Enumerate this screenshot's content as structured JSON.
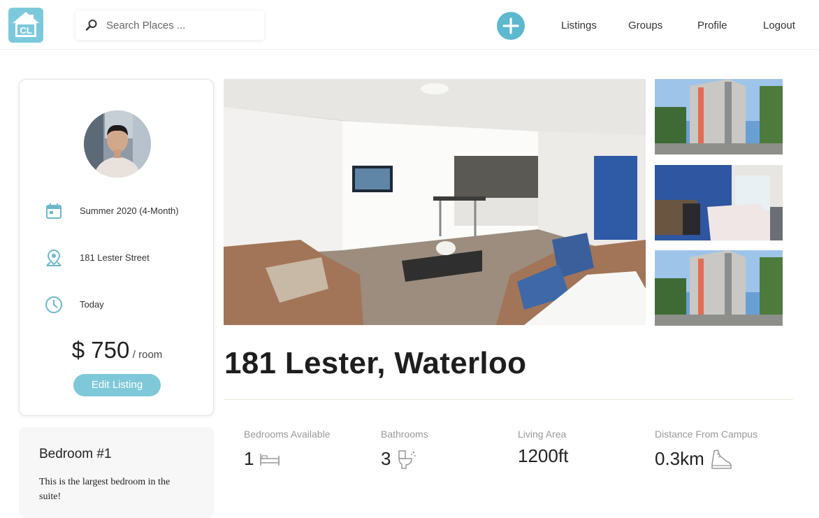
{
  "header": {
    "logo_text": "CL",
    "search_placeholder": "Search Places ...",
    "nav": [
      "Listings",
      "Groups",
      "Profile",
      "Logout"
    ]
  },
  "info": {
    "term": "Summer 2020 (4-Month)",
    "address": "181 Lester Street",
    "available": "Today",
    "price_amount": "$ 750",
    "price_unit": "/ room",
    "edit_label": "Edit Listing"
  },
  "bedroom": {
    "title": "Bedroom #1",
    "description": "This is the largest bedroom in the suite!"
  },
  "listing": {
    "title": "181 Lester, Waterloo"
  },
  "stats": [
    {
      "label": "Bedrooms Available",
      "value": "1",
      "icon": "bed-icon"
    },
    {
      "label": "Bathrooms",
      "value": "3",
      "icon": "toilet-icon"
    },
    {
      "label": "Living Area",
      "value": "1200ft",
      "icon": ""
    },
    {
      "label": "Distance From Campus",
      "value": "0.3km",
      "icon": "shoe-icon"
    }
  ],
  "colors": {
    "accent": "#5bb8cf",
    "button": "#7ec8d9",
    "icon": "#6cb7ca"
  }
}
